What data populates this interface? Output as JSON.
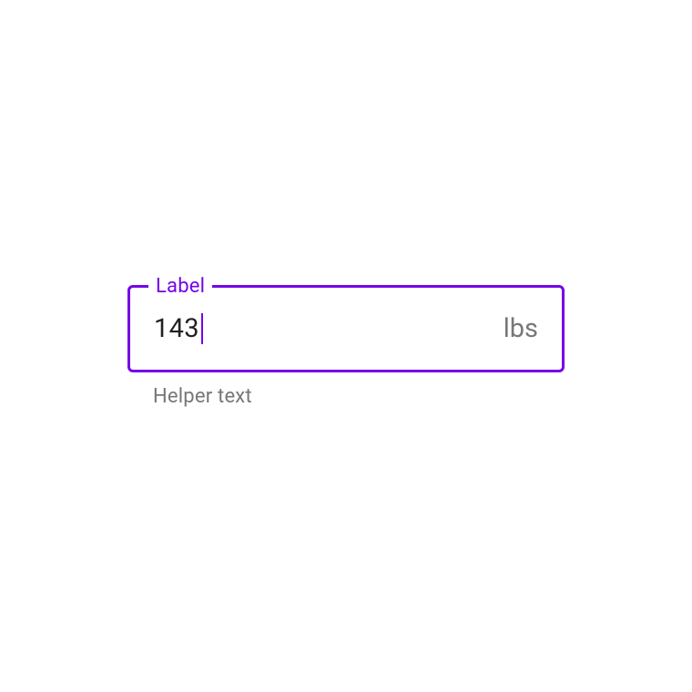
{
  "field": {
    "label": "Label",
    "value": "143",
    "suffix": "lbs",
    "helper": "Helper text"
  },
  "colors": {
    "accent": "#7403e8",
    "text": "#212121",
    "muted": "#777777"
  }
}
